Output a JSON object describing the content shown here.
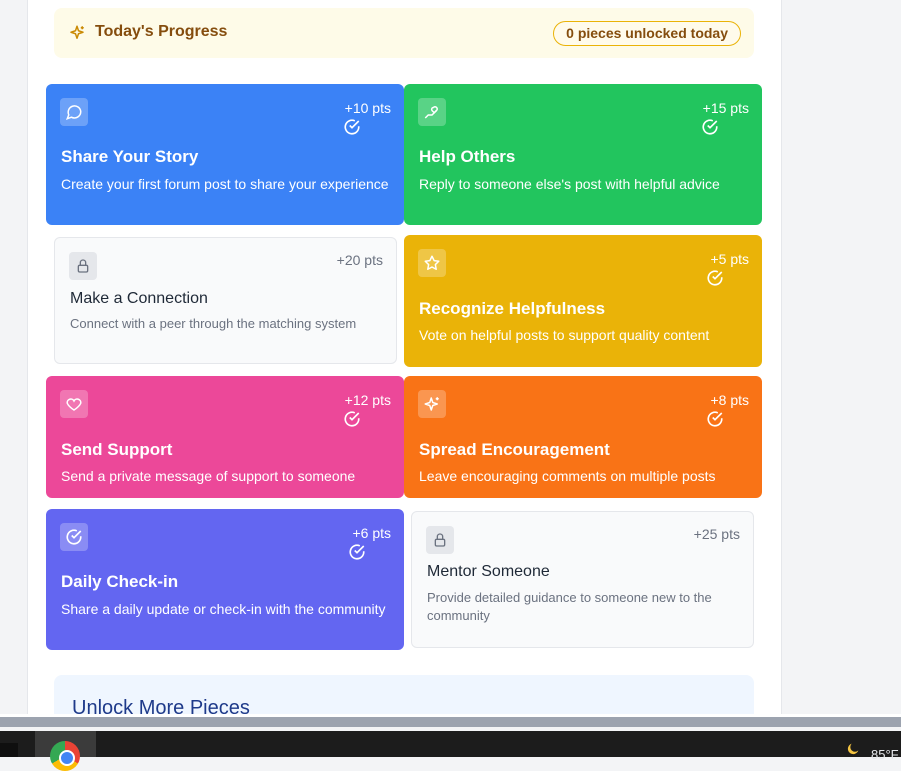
{
  "progress": {
    "icon": "sparkles-icon",
    "title": "Today's Progress",
    "badge": "0 pieces unlocked today",
    "accent": "#854d0e"
  },
  "cards": [
    {
      "id": "share-your-story",
      "title": "Share Your Story",
      "desc": "Create your first forum post to share your experience",
      "pts": "+10 pts",
      "icon": "message-circle-icon",
      "completed": true,
      "color": "#3b82f6"
    },
    {
      "id": "help-others",
      "title": "Help Others",
      "desc": "Reply to someone else's post with helpful advice",
      "pts": "+15 pts",
      "icon": "hand-heart-icon",
      "completed": true,
      "color": "#22c55e"
    },
    {
      "id": "make-a-connection",
      "title": "Make a Connection",
      "desc": "Connect with a peer through the matching system",
      "pts": "+20 pts",
      "icon": "lock-icon",
      "completed": false,
      "color": "#f9fafb"
    },
    {
      "id": "recognize-helpfulness",
      "title": "Recognize Helpfulness",
      "desc": "Vote on helpful posts to support quality content",
      "pts": "+5 pts",
      "icon": "star-icon",
      "completed": true,
      "color": "#eab308"
    },
    {
      "id": "send-support",
      "title": "Send Support",
      "desc": "Send a private message of support to someone",
      "pts": "+12 pts",
      "icon": "heart-icon",
      "completed": true,
      "color": "#ec4899"
    },
    {
      "id": "spread-encouragement",
      "title": "Spread Encouragement",
      "desc": "Leave encouraging comments on multiple posts",
      "pts": "+8 pts",
      "icon": "sparkles-icon",
      "completed": true,
      "color": "#f97316"
    },
    {
      "id": "daily-check-in",
      "title": "Daily Check-in",
      "desc": "Share a daily update or check-in with the community",
      "pts": "+6 pts",
      "icon": "check-circle-icon",
      "completed": true,
      "color": "#6366f1"
    },
    {
      "id": "mentor-someone",
      "title": "Mentor Someone",
      "desc": "Provide detailed guidance to someone new to the community",
      "pts": "+25 pts",
      "icon": "lock-icon",
      "completed": false,
      "color": "#f9fafb"
    }
  ],
  "unlock_section": {
    "title": "Unlock More Pieces"
  },
  "taskbar": {
    "browser_icon": "chrome-icon",
    "weather_icon": "moon-icon",
    "temperature": "85°F"
  }
}
